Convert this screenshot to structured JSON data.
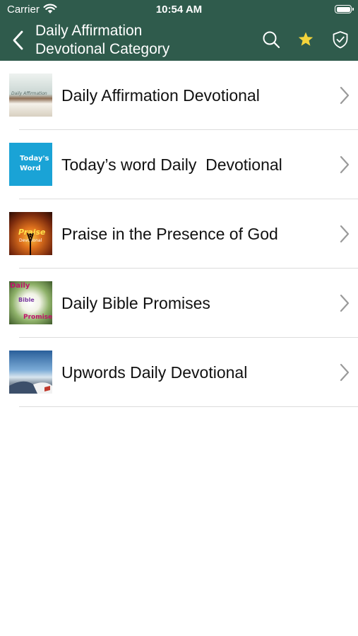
{
  "status_bar": {
    "carrier": "Carrier",
    "time": "10:54 AM"
  },
  "nav": {
    "title_line1": "Daily Affirmation",
    "title_line2": "Devotional Category",
    "icons": [
      "back-chevron-icon",
      "search-icon",
      "star-icon",
      "shield-check-icon"
    ]
  },
  "colors": {
    "bar": "#2f5b4c",
    "star": "#f4d43b",
    "chevron": "#9a9a9a",
    "separator": "#dcdcdc"
  },
  "items": [
    {
      "label": "Daily Affirmation Devotional",
      "thumb_text": "Daily Affirmation"
    },
    {
      "label": "Today’s word Daily  Devotional",
      "thumb_text_1": "Today's",
      "thumb_text_2": "Word"
    },
    {
      "label": "Praise in the Presence of God",
      "thumb_text_1": "Praise",
      "thumb_text_2": "Devotional"
    },
    {
      "label": "Daily Bible Promises",
      "thumb_text_1": "Daily",
      "thumb_text_2": "Bible",
      "thumb_text_3": "Promise"
    },
    {
      "label": "Upwords Daily Devotional"
    }
  ]
}
